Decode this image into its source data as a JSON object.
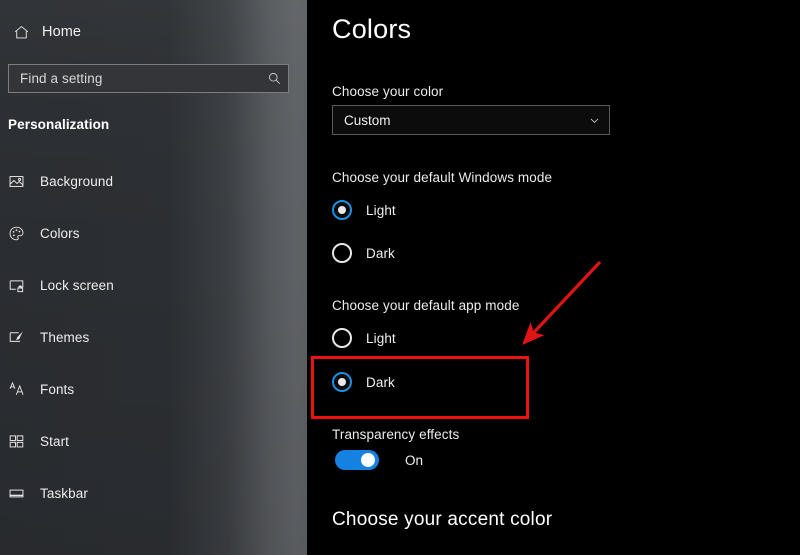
{
  "sidebar": {
    "home": {
      "label": "Home",
      "icon": "home-icon"
    },
    "search": {
      "placeholder": "Find a setting",
      "value": "",
      "icon": "search-icon"
    },
    "section_title": "Personalization",
    "items": [
      {
        "label": "Background",
        "icon": "image-icon"
      },
      {
        "label": "Colors",
        "icon": "palette-icon"
      },
      {
        "label": "Lock screen",
        "icon": "lock-screen-icon"
      },
      {
        "label": "Themes",
        "icon": "themes-brush-icon"
      },
      {
        "label": "Fonts",
        "icon": "fonts-aa-icon"
      },
      {
        "label": "Start",
        "icon": "start-tiles-icon"
      },
      {
        "label": "Taskbar",
        "icon": "taskbar-icon"
      }
    ]
  },
  "main": {
    "page_title": "Colors",
    "choose_color": {
      "label": "Choose your color",
      "selected": "Custom",
      "chevron": "chevron-down-icon"
    },
    "windows_mode": {
      "label": "Choose your default Windows mode",
      "options": [
        {
          "label": "Light",
          "checked": true
        },
        {
          "label": "Dark",
          "checked": false
        }
      ]
    },
    "app_mode": {
      "label": "Choose your default app mode",
      "options": [
        {
          "label": "Light",
          "checked": false
        },
        {
          "label": "Dark",
          "checked": true
        }
      ]
    },
    "transparency": {
      "label": "Transparency effects",
      "state": "On",
      "checked": true
    },
    "accent_heading": "Choose your accent color"
  },
  "annotations": {
    "highlight_color": "#ee1111",
    "arrow_color": "#e01414",
    "highlight_target": "app-mode-dark-option",
    "arrow_points_to": "app-mode-dark-option"
  },
  "colors": {
    "accent_blue": "#1581e0",
    "radio_selected_ring": "#1a8fe0",
    "background": "#000000",
    "sidebar_dark": "#2a2d31",
    "sidebar_light": "#5c5f63"
  }
}
